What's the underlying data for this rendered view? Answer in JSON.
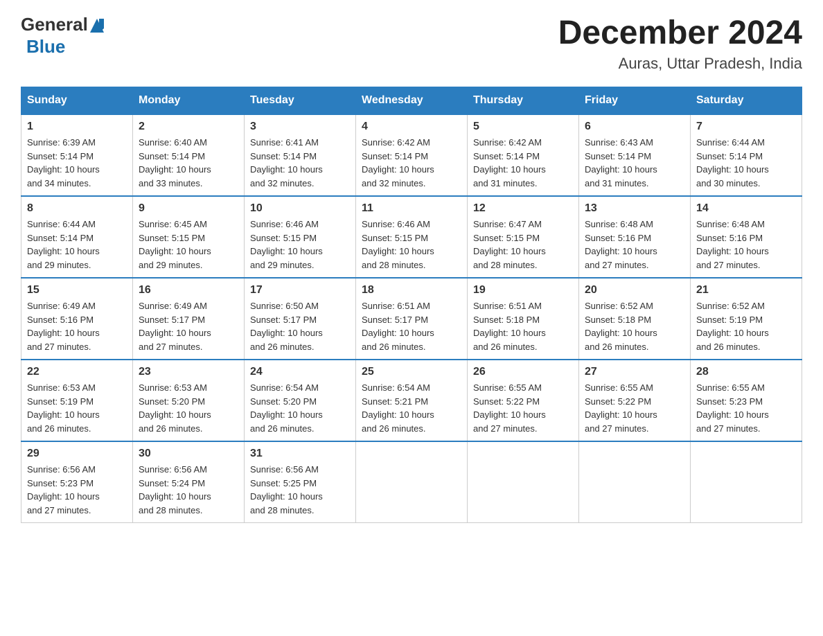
{
  "logo": {
    "general": "General",
    "blue": "Blue"
  },
  "title": "December 2024",
  "location": "Auras, Uttar Pradesh, India",
  "days_of_week": [
    "Sunday",
    "Monday",
    "Tuesday",
    "Wednesday",
    "Thursday",
    "Friday",
    "Saturday"
  ],
  "weeks": [
    [
      {
        "day": "1",
        "sunrise": "6:39 AM",
        "sunset": "5:14 PM",
        "daylight": "10 hours and 34 minutes."
      },
      {
        "day": "2",
        "sunrise": "6:40 AM",
        "sunset": "5:14 PM",
        "daylight": "10 hours and 33 minutes."
      },
      {
        "day": "3",
        "sunrise": "6:41 AM",
        "sunset": "5:14 PM",
        "daylight": "10 hours and 32 minutes."
      },
      {
        "day": "4",
        "sunrise": "6:42 AM",
        "sunset": "5:14 PM",
        "daylight": "10 hours and 32 minutes."
      },
      {
        "day": "5",
        "sunrise": "6:42 AM",
        "sunset": "5:14 PM",
        "daylight": "10 hours and 31 minutes."
      },
      {
        "day": "6",
        "sunrise": "6:43 AM",
        "sunset": "5:14 PM",
        "daylight": "10 hours and 31 minutes."
      },
      {
        "day": "7",
        "sunrise": "6:44 AM",
        "sunset": "5:14 PM",
        "daylight": "10 hours and 30 minutes."
      }
    ],
    [
      {
        "day": "8",
        "sunrise": "6:44 AM",
        "sunset": "5:14 PM",
        "daylight": "10 hours and 29 minutes."
      },
      {
        "day": "9",
        "sunrise": "6:45 AM",
        "sunset": "5:15 PM",
        "daylight": "10 hours and 29 minutes."
      },
      {
        "day": "10",
        "sunrise": "6:46 AM",
        "sunset": "5:15 PM",
        "daylight": "10 hours and 29 minutes."
      },
      {
        "day": "11",
        "sunrise": "6:46 AM",
        "sunset": "5:15 PM",
        "daylight": "10 hours and 28 minutes."
      },
      {
        "day": "12",
        "sunrise": "6:47 AM",
        "sunset": "5:15 PM",
        "daylight": "10 hours and 28 minutes."
      },
      {
        "day": "13",
        "sunrise": "6:48 AM",
        "sunset": "5:16 PM",
        "daylight": "10 hours and 27 minutes."
      },
      {
        "day": "14",
        "sunrise": "6:48 AM",
        "sunset": "5:16 PM",
        "daylight": "10 hours and 27 minutes."
      }
    ],
    [
      {
        "day": "15",
        "sunrise": "6:49 AM",
        "sunset": "5:16 PM",
        "daylight": "10 hours and 27 minutes."
      },
      {
        "day": "16",
        "sunrise": "6:49 AM",
        "sunset": "5:17 PM",
        "daylight": "10 hours and 27 minutes."
      },
      {
        "day": "17",
        "sunrise": "6:50 AM",
        "sunset": "5:17 PM",
        "daylight": "10 hours and 26 minutes."
      },
      {
        "day": "18",
        "sunrise": "6:51 AM",
        "sunset": "5:17 PM",
        "daylight": "10 hours and 26 minutes."
      },
      {
        "day": "19",
        "sunrise": "6:51 AM",
        "sunset": "5:18 PM",
        "daylight": "10 hours and 26 minutes."
      },
      {
        "day": "20",
        "sunrise": "6:52 AM",
        "sunset": "5:18 PM",
        "daylight": "10 hours and 26 minutes."
      },
      {
        "day": "21",
        "sunrise": "6:52 AM",
        "sunset": "5:19 PM",
        "daylight": "10 hours and 26 minutes."
      }
    ],
    [
      {
        "day": "22",
        "sunrise": "6:53 AM",
        "sunset": "5:19 PM",
        "daylight": "10 hours and 26 minutes."
      },
      {
        "day": "23",
        "sunrise": "6:53 AM",
        "sunset": "5:20 PM",
        "daylight": "10 hours and 26 minutes."
      },
      {
        "day": "24",
        "sunrise": "6:54 AM",
        "sunset": "5:20 PM",
        "daylight": "10 hours and 26 minutes."
      },
      {
        "day": "25",
        "sunrise": "6:54 AM",
        "sunset": "5:21 PM",
        "daylight": "10 hours and 26 minutes."
      },
      {
        "day": "26",
        "sunrise": "6:55 AM",
        "sunset": "5:22 PM",
        "daylight": "10 hours and 27 minutes."
      },
      {
        "day": "27",
        "sunrise": "6:55 AM",
        "sunset": "5:22 PM",
        "daylight": "10 hours and 27 minutes."
      },
      {
        "day": "28",
        "sunrise": "6:55 AM",
        "sunset": "5:23 PM",
        "daylight": "10 hours and 27 minutes."
      }
    ],
    [
      {
        "day": "29",
        "sunrise": "6:56 AM",
        "sunset": "5:23 PM",
        "daylight": "10 hours and 27 minutes."
      },
      {
        "day": "30",
        "sunrise": "6:56 AM",
        "sunset": "5:24 PM",
        "daylight": "10 hours and 28 minutes."
      },
      {
        "day": "31",
        "sunrise": "6:56 AM",
        "sunset": "5:25 PM",
        "daylight": "10 hours and 28 minutes."
      },
      null,
      null,
      null,
      null
    ]
  ],
  "labels": {
    "sunrise": "Sunrise:",
    "sunset": "Sunset:",
    "daylight": "Daylight:"
  }
}
